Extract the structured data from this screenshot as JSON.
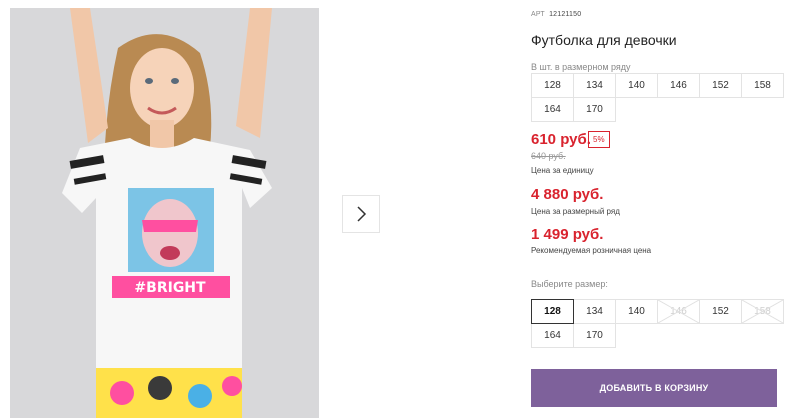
{
  "product": {
    "article_label": "АРТ",
    "article_value": "12121150",
    "title": "Футболка для девочки"
  },
  "size_row": {
    "label": "В шт. в размерном ряду",
    "sizes": [
      "128",
      "134",
      "140",
      "146",
      "152",
      "158",
      "164",
      "170"
    ]
  },
  "pricing": {
    "price": "610 руб.",
    "discount": "5%",
    "old_price": "640 руб.",
    "unit_note": "Цена за единицу",
    "row_price": "4 880 руб.",
    "row_note": "Цена за размерный ряд",
    "rrp": "1 499 руб.",
    "rrp_note": "Рекомендуемая розничная цена",
    "accent_color": "#d9232e"
  },
  "size_picker": {
    "label": "Выберите размер:",
    "sizes": [
      {
        "label": "128",
        "state": "selected"
      },
      {
        "label": "134",
        "state": "available"
      },
      {
        "label": "140",
        "state": "available"
      },
      {
        "label": "146",
        "state": "disabled"
      },
      {
        "label": "152",
        "state": "available"
      },
      {
        "label": "158",
        "state": "disabled"
      },
      {
        "label": "164",
        "state": "available"
      },
      {
        "label": "170",
        "state": "available"
      }
    ]
  },
  "cart": {
    "button_label": "ДОБАВИТЬ В КОРЗИНУ",
    "color": "#7e619b"
  },
  "gallery": {
    "next_icon": "chevron-right-icon",
    "shirt_print": "#BRIGHT"
  }
}
